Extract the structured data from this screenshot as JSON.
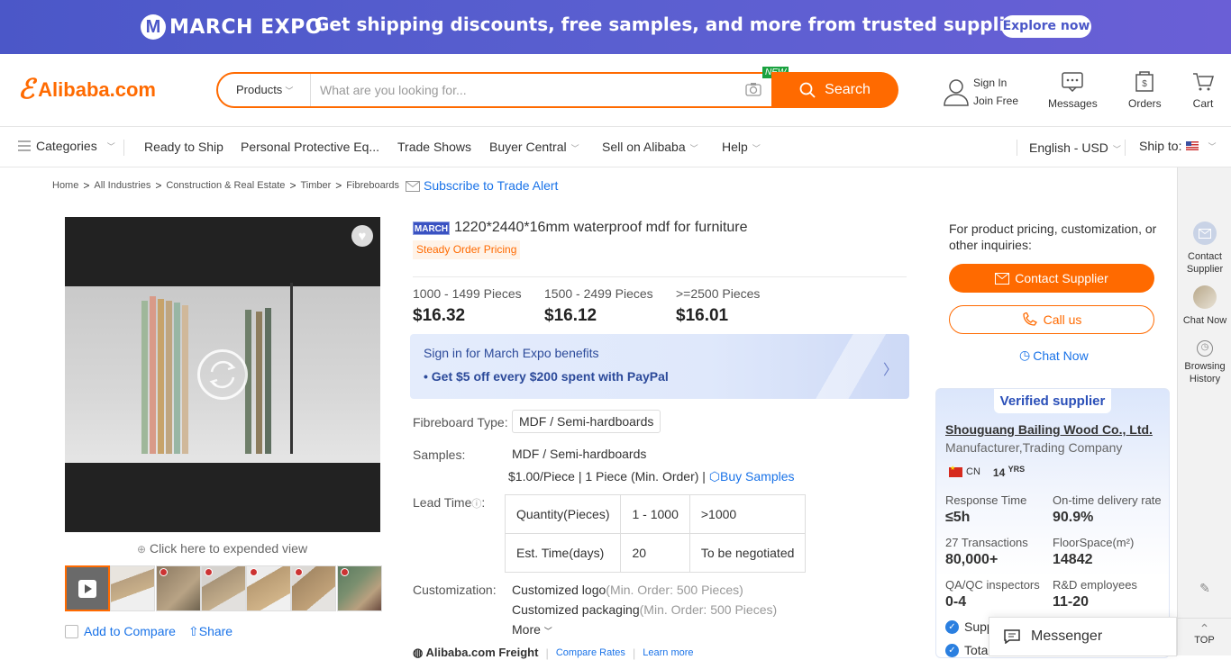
{
  "banner": {
    "logo_text": "MARCH EXPO",
    "message": "Get shipping discounts, free samples, and more from trusted suppliers",
    "cta": "Explore now",
    "bg_color": "#4b57c8"
  },
  "header": {
    "logo_text": "Alibaba.com",
    "search": {
      "category": "Products",
      "placeholder": "What are you looking for...",
      "new_badge": "NEW",
      "button": "Search"
    },
    "account": {
      "sign_in": "Sign In",
      "join": "Join Free"
    },
    "icons": [
      {
        "label": "Messages",
        "icon": "messages-icon"
      },
      {
        "label": "Orders",
        "icon": "orders-icon"
      },
      {
        "label": "Cart",
        "icon": "cart-icon"
      }
    ],
    "accent_color": "#ff6a00"
  },
  "nav": {
    "categories": "Categories",
    "items": [
      "Ready to Ship",
      "Personal Protective Eq...",
      "Trade Shows",
      "Buyer Central",
      "Sell on Alibaba",
      "Help"
    ],
    "language": "English - USD",
    "ship_to": "Ship to:"
  },
  "breadcrumb": {
    "items": [
      "Home",
      "All Industries",
      "Construction & Real Estate",
      "Timber",
      "Fibreboards"
    ],
    "subscribe": "Subscribe to Trade Alert"
  },
  "gallery": {
    "expand_text": "Click here to expended view",
    "compare": "Add to Compare",
    "share": "Share"
  },
  "product": {
    "badge": "MARCH",
    "title": "1220*2440*16mm waterproof mdf for furniture",
    "tag": "Steady Order Pricing",
    "prices": [
      {
        "range": "1000 - 1499 Pieces",
        "price": "$16.32"
      },
      {
        "range": "1500 - 2499 Pieces",
        "price": "$16.12"
      },
      {
        "range": ">=2500 Pieces",
        "price": "$16.01"
      }
    ],
    "promo": {
      "line1": "Sign in for March Expo benefits",
      "line2": "• Get $5 off every $200 spent with PayPal"
    },
    "fibreboard_label": "Fibreboard Type:",
    "fibreboard_value": "MDF / Semi-hardboards",
    "samples_label": "Samples:",
    "samples_value": "MDF / Semi-hardboards",
    "samples_price": "$1.00/Piece | 1 Piece (Min. Order) |",
    "buy_samples": "Buy Samples",
    "lead_label": "Lead Time",
    "lead_table": {
      "header": [
        "Quantity(Pieces)",
        "1 - 1000",
        ">1000"
      ],
      "row": [
        "Est. Time(days)",
        "20",
        "To be negotiated"
      ]
    },
    "custom_label": "Customization:",
    "custom_items": [
      {
        "name": "Customized logo",
        "min": "(Min. Order: 500 Pieces)"
      },
      {
        "name": "Customized packaging",
        "min": "(Min. Order: 500 Pieces)"
      }
    ],
    "more": "More",
    "freight": "Alibaba.com Freight",
    "compare_rates": "Compare Rates",
    "learn_more": "Learn more"
  },
  "contact": {
    "inquiry": "For product pricing, customization, or other inquiries:",
    "contact_button": "Contact Supplier",
    "call_button": "Call us",
    "chat": "Chat Now"
  },
  "supplier": {
    "verified": "Verified supplier",
    "name": "Shouguang Bailing Wood Co., Ltd.",
    "type": "Manufacturer,Trading Company",
    "country": "CN",
    "years": "14",
    "years_unit": "YRS",
    "stats": [
      {
        "label": "Response Time",
        "value": "≤5h"
      },
      {
        "label": "On-time delivery rate",
        "value": "90.9%"
      },
      {
        "label": "27 Transactions",
        "value": "80,000+"
      },
      {
        "label": "FloorSpace(m²)",
        "value": "14842"
      },
      {
        "label": "QA/QC inspectors",
        "value": "0-4"
      },
      {
        "label": "R&D employees",
        "value": "11-20"
      }
    ],
    "line1": "Supp",
    "line2": "Tota"
  },
  "rside": {
    "contact": "Contact Supplier",
    "chat": "Chat Now",
    "history": "Browsing History",
    "top": "TOP"
  },
  "messenger": "Messenger"
}
